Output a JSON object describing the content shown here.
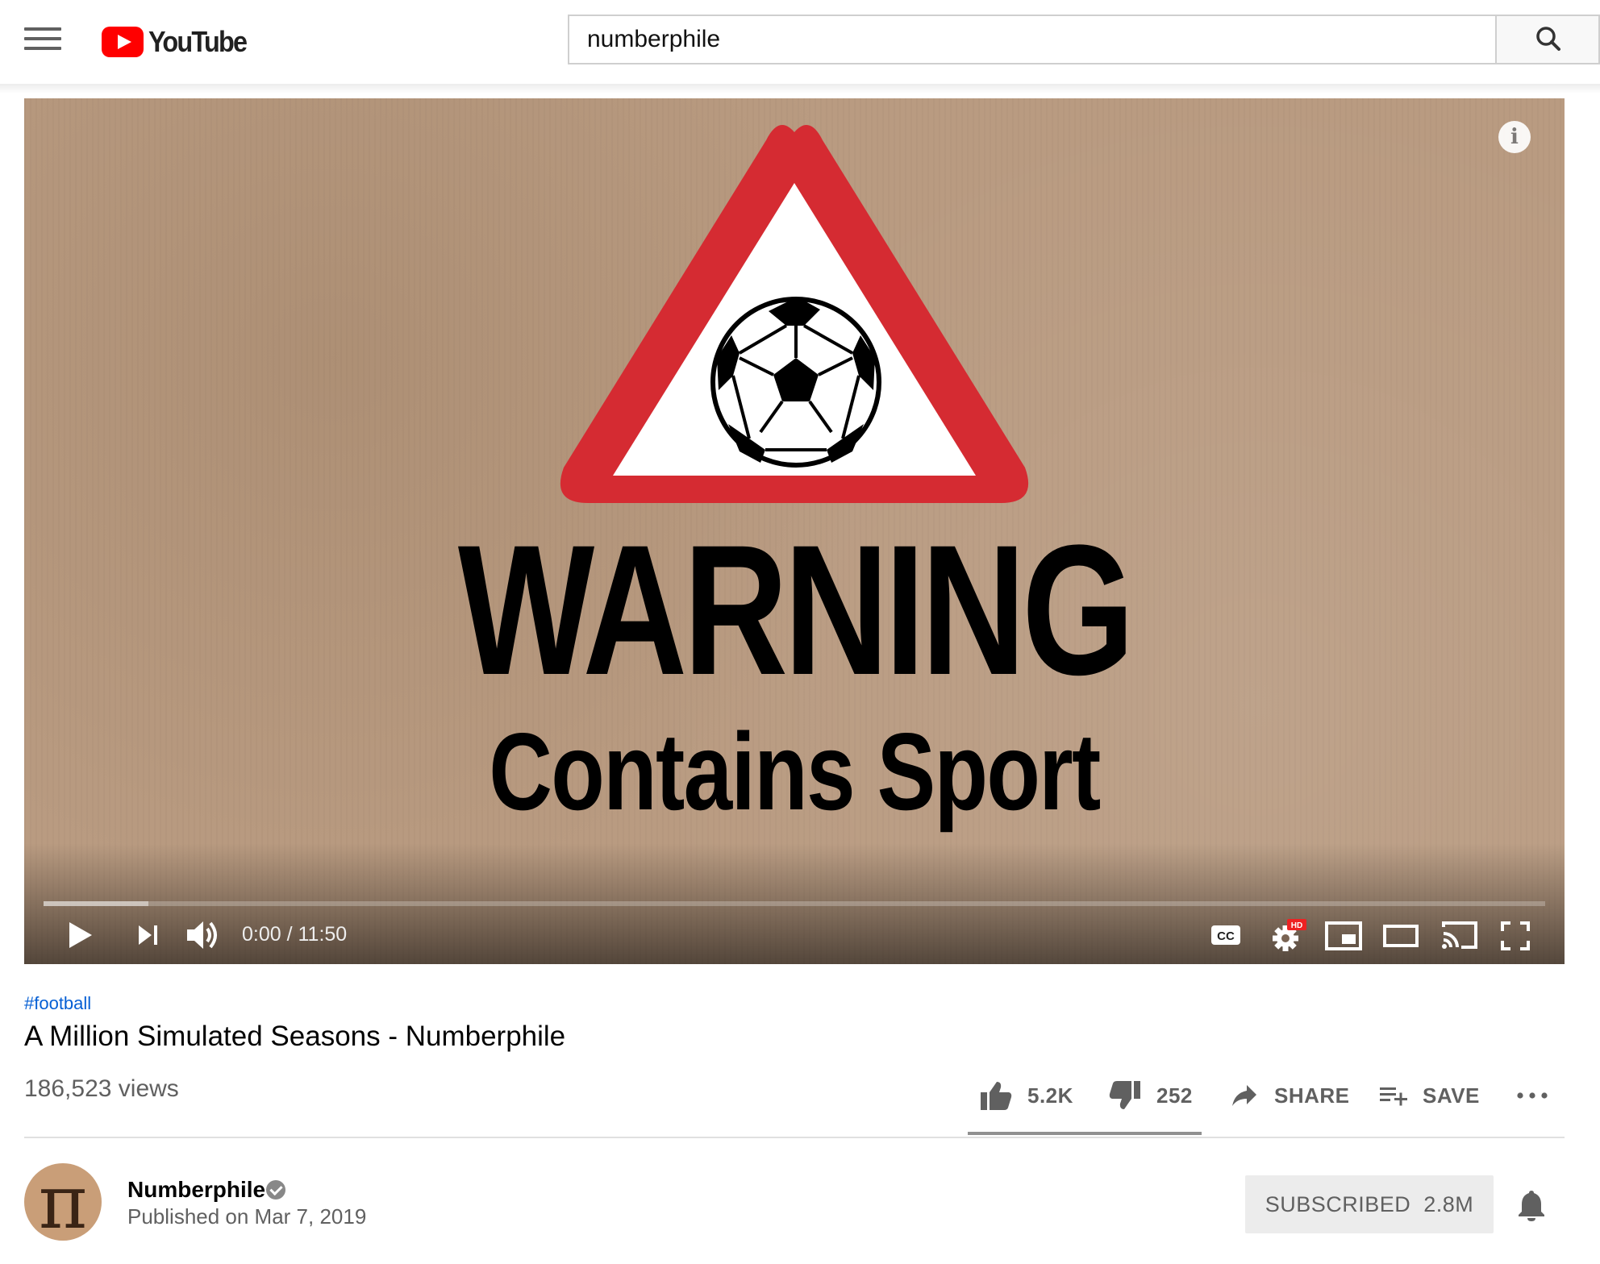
{
  "header": {
    "logo_text": "YouTube",
    "search": {
      "value": "numberphile"
    }
  },
  "player": {
    "overlay_title": "WARNING",
    "overlay_subtitle": "Contains Sport",
    "time_display": "0:00 / 11:50",
    "buffered_fraction": 0.07
  },
  "video": {
    "hashtag": "#football",
    "title": "A Million Simulated Seasons - Numberphile",
    "views": "186,523 views",
    "likes": "5.2K",
    "dislikes": "252",
    "share_label": "SHARE",
    "save_label": "SAVE"
  },
  "channel": {
    "name": "Numberphile",
    "published": "Published on Mar 7, 2019",
    "subscribe_label": "SUBSCRIBED",
    "subscriber_count": "2.8M",
    "avatar_glyph": "π"
  },
  "colors": {
    "brand_red": "#ff0000",
    "link_blue": "#065fd4",
    "warning_red": "#d52b32"
  },
  "icons": [
    "menu-icon",
    "search-icon",
    "info-icon",
    "play-icon",
    "next-icon",
    "volume-icon",
    "captions-icon",
    "settings-icon",
    "miniplayer-icon",
    "theater-icon",
    "cast-icon",
    "fullscreen-icon",
    "thumbs-up-icon",
    "thumbs-down-icon",
    "share-icon",
    "save-playlist-icon",
    "more-icon",
    "verified-icon",
    "bell-icon"
  ]
}
